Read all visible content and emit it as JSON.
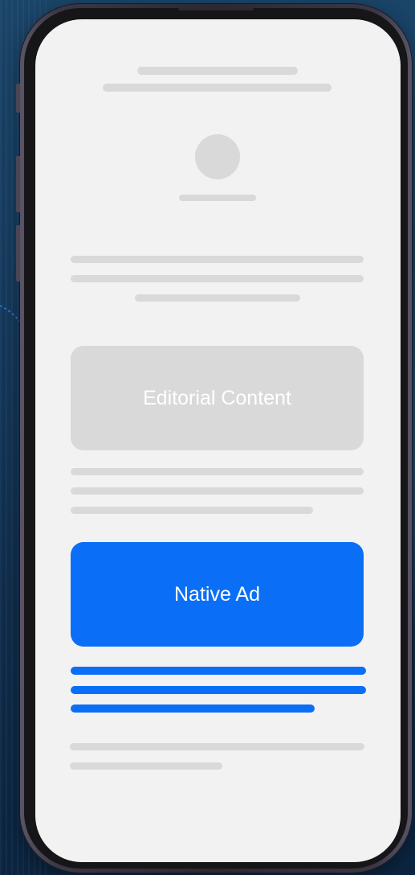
{
  "editorial": {
    "label": "Editorial Content"
  },
  "ad": {
    "label": "Native Ad"
  },
  "colors": {
    "background": "#163a5b",
    "screen": "#f2f2f2",
    "placeholder": "#d9d9d9",
    "accent": "#0a6ff6"
  }
}
